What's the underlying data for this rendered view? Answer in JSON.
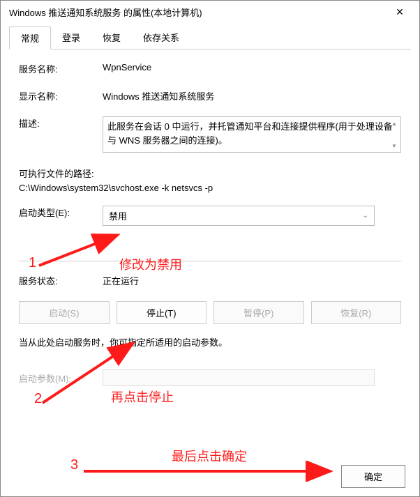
{
  "window": {
    "title": "Windows 推送通知系统服务 的属性(本地计算机)"
  },
  "tabs": {
    "general": "常规",
    "logon": "登录",
    "recovery": "恢复",
    "dependencies": "依存关系"
  },
  "fields": {
    "service_name_label": "服务名称:",
    "service_name_value": "WpnService",
    "display_name_label": "显示名称:",
    "display_name_value": "Windows 推送通知系统服务",
    "description_label": "描述:",
    "description_value": "此服务在会话 0 中运行，并托管通知平台和连接提供程序(用于处理设备与 WNS 服务器之间的连接)。",
    "exe_path_label": "可执行文件的路径:",
    "exe_path_value": "C:\\Windows\\system32\\svchost.exe -k netsvcs -p",
    "startup_type_label": "启动类型(E):",
    "startup_type_value": "禁用",
    "service_status_label": "服务状态:",
    "service_status_value": "正在运行",
    "hint": "当从此处启动服务时，你可指定所适用的启动参数。",
    "start_params_label": "启动参数(M):",
    "start_params_value": ""
  },
  "buttons": {
    "start": "启动(S)",
    "stop": "停止(T)",
    "pause": "暂停(P)",
    "resume": "恢复(R)",
    "ok": "确定"
  },
  "annotations": {
    "n1": "1",
    "n2": "2",
    "n3": "3",
    "a1": "修改为禁用",
    "a2": "再点击停止",
    "a3": "最后点击确定"
  }
}
